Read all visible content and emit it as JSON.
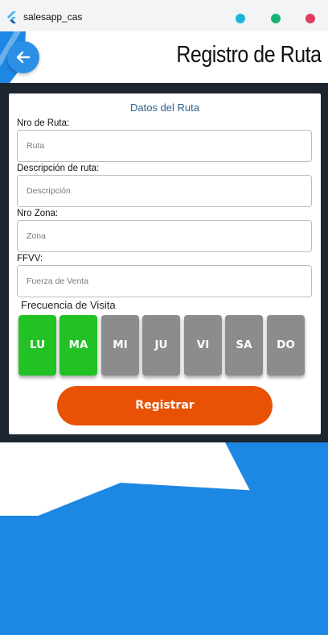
{
  "window": {
    "app_title": "salesapp_cas",
    "colors": {
      "dot1": "#1ab6d8",
      "dot2": "#17b36f",
      "dot3": "#e33b5a"
    }
  },
  "header": {
    "back_icon": "arrow-left-icon",
    "title": "Registro de Ruta"
  },
  "form": {
    "section_title": "Datos del Ruta",
    "fields": [
      {
        "label": "Nro de Ruta:",
        "placeholder": "Ruta",
        "value": ""
      },
      {
        "label": "Descripción de ruta:",
        "placeholder": "Descripción",
        "value": ""
      },
      {
        "label": "Nro Zona:",
        "placeholder": "Zona",
        "value": ""
      },
      {
        "label": "FFVV:",
        "placeholder": "Fuerza de Venta",
        "value": ""
      }
    ],
    "frequency_label": "Frecuencia de Visita",
    "days": [
      {
        "label": "LU",
        "selected": true
      },
      {
        "label": "MA",
        "selected": true
      },
      {
        "label": "MI",
        "selected": false
      },
      {
        "label": "JU",
        "selected": false
      },
      {
        "label": "VI",
        "selected": false
      },
      {
        "label": "SA",
        "selected": false
      },
      {
        "label": "DO",
        "selected": false
      }
    ],
    "submit_label": "Registrar"
  },
  "colors": {
    "accent_blue": "#2b8fe6",
    "day_selected": "#22c124",
    "day_unselected": "#8c8c8c",
    "submit": "#e85205",
    "frame": "#1c2530"
  }
}
